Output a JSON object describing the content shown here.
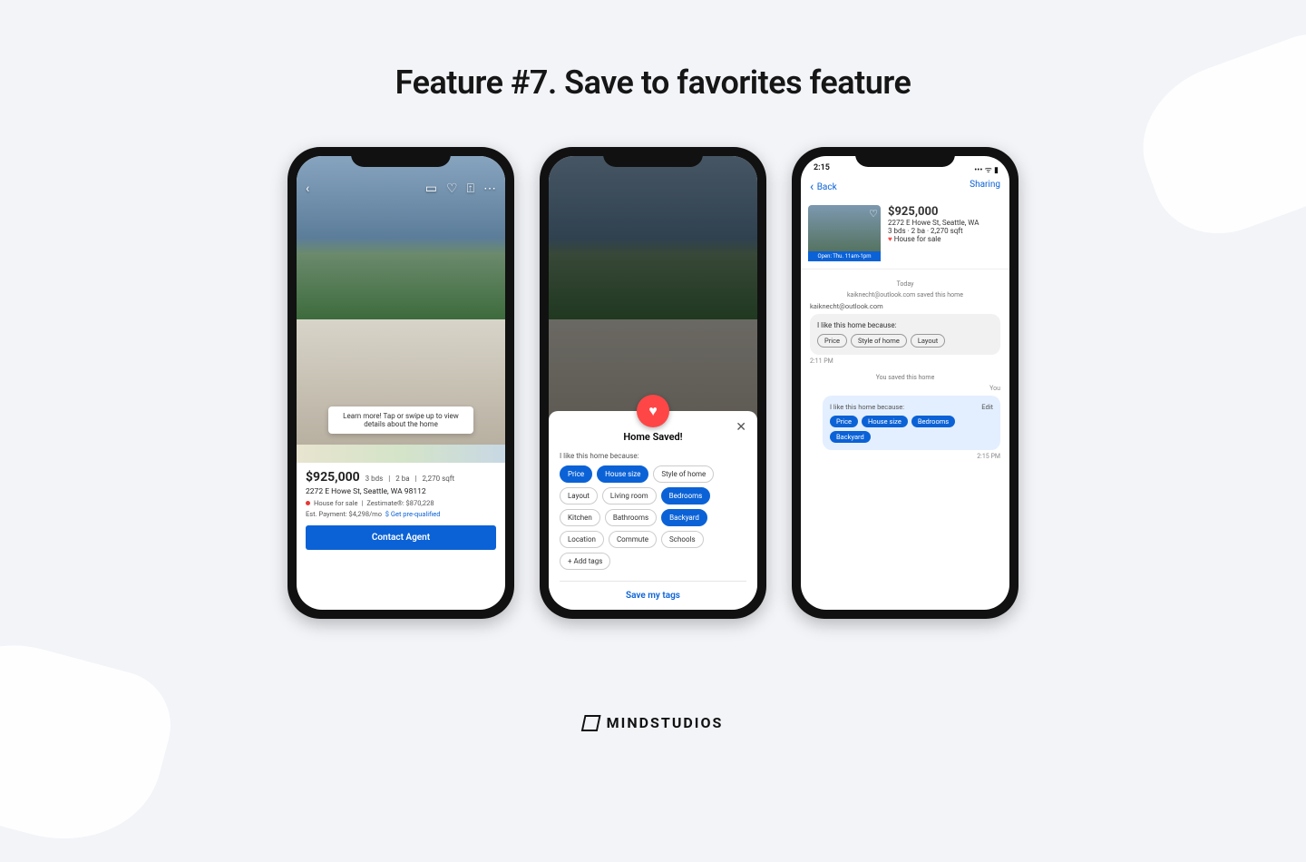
{
  "title": "Feature #7. Save to favorites feature",
  "brand": "MINDSTUDIOS",
  "p1": {
    "tooltip": "Learn more! Tap or swipe up to view details about the home",
    "price": "$925,000",
    "beds": "3 bds",
    "baths": "2 ba",
    "sqft": "2,270 sqft",
    "address": "2272 E Howe St, Seattle, WA 98112",
    "status": "House for sale",
    "zestimate": "Zestimate®: $870,228",
    "est": "Est. Payment: $4,298/mo",
    "prequal": "Get pre-qualified",
    "cta": "Contact Agent"
  },
  "p2": {
    "title": "Home Saved!",
    "sub": "I like this home because:",
    "tags": [
      {
        "label": "Price",
        "sel": true
      },
      {
        "label": "House size",
        "sel": true
      },
      {
        "label": "Style of home",
        "sel": false
      },
      {
        "label": "Layout",
        "sel": false
      },
      {
        "label": "Living room",
        "sel": false
      },
      {
        "label": "Bedrooms",
        "sel": true
      },
      {
        "label": "Kitchen",
        "sel": false
      },
      {
        "label": "Bathrooms",
        "sel": false
      },
      {
        "label": "Backyard",
        "sel": true
      },
      {
        "label": "Location",
        "sel": false
      },
      {
        "label": "Commute",
        "sel": false
      },
      {
        "label": "Schools",
        "sel": false
      },
      {
        "label": "+ Add tags",
        "sel": false
      }
    ],
    "save": "Save my tags"
  },
  "p3": {
    "clock": "2:15",
    "back": "Back",
    "sharing": "Sharing",
    "price": "$925,000",
    "address": "2272 E Howe St, Seattle, WA",
    "meta": "3 bds · 2 ba · 2,270 sqft",
    "status": "House for sale",
    "open": "Open: Thu. 11am-1pm",
    "today": "Today",
    "saved_by": "kaiknecht@outlook.com saved this home",
    "user": "kaiknecht@outlook.com",
    "like_label": "I like this home because:",
    "gray_tags": [
      "Price",
      "Style of home",
      "Layout"
    ],
    "ts1": "2:11 PM",
    "you_saved": "You saved this home",
    "you": "You",
    "edit": "Edit",
    "blue_tags": [
      "Price",
      "House size",
      "Bedrooms",
      "Backyard"
    ],
    "ts2": "2:15 PM"
  }
}
